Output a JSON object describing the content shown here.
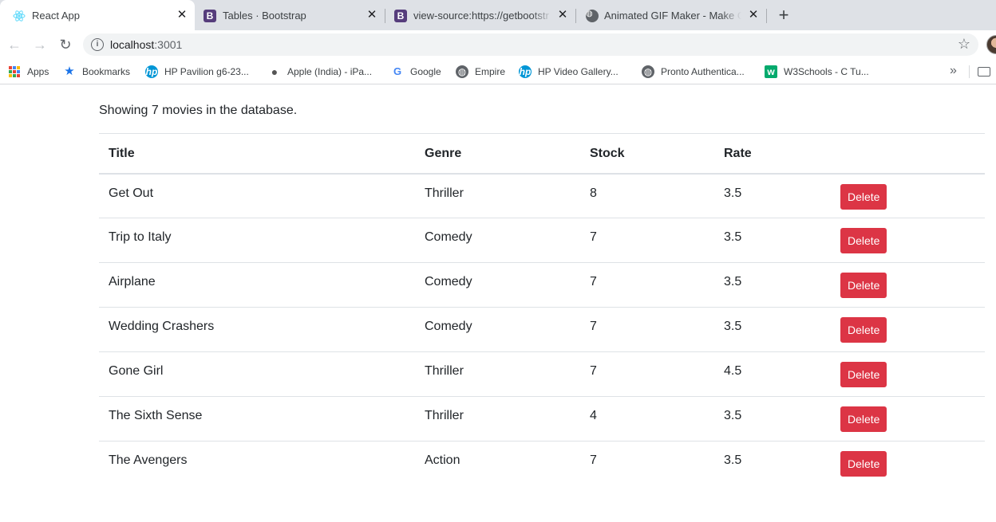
{
  "browser": {
    "tabs": [
      {
        "title": "React App",
        "icon": "react-icon"
      },
      {
        "title": "Tables · Bootstrap",
        "icon": "bootstrap-icon"
      },
      {
        "title": "view-source:https://getbootstr",
        "icon": "bootstrap-icon"
      },
      {
        "title": "Animated GIF Maker - Make GI",
        "icon": "globe-icon"
      }
    ],
    "new_tab": "+",
    "url_host": "localhost",
    "url_port": ":3001",
    "bookmarks": [
      {
        "label": "Apps",
        "icon": "apps-grid-icon"
      },
      {
        "label": "Bookmarks",
        "icon": "star-icon"
      },
      {
        "label": "HP Pavilion g6-23...",
        "icon": "hp-icon"
      },
      {
        "label": "Apple (India) - iPa...",
        "icon": "apple-icon"
      },
      {
        "label": "Google",
        "icon": "google-icon"
      },
      {
        "label": "Empire",
        "icon": "globe-icon"
      },
      {
        "label": "HP Video Gallery...",
        "icon": "hp-icon"
      },
      {
        "label": "Pronto Authentica...",
        "icon": "globe-icon"
      },
      {
        "label": "W3Schools - C Tu...",
        "icon": "w3schools-icon"
      }
    ]
  },
  "page": {
    "summary": "Showing 7 movies in the database.",
    "columns": [
      "Title",
      "Genre",
      "Stock",
      "Rate"
    ],
    "delete_label": "Delete",
    "movies": [
      {
        "title": "Get Out",
        "genre": "Thriller",
        "stock": "8",
        "rate": "3.5"
      },
      {
        "title": "Trip to Italy",
        "genre": "Comedy",
        "stock": "7",
        "rate": "3.5"
      },
      {
        "title": "Airplane",
        "genre": "Comedy",
        "stock": "7",
        "rate": "3.5"
      },
      {
        "title": "Wedding Crashers",
        "genre": "Comedy",
        "stock": "7",
        "rate": "3.5"
      },
      {
        "title": "Gone Girl",
        "genre": "Thriller",
        "stock": "7",
        "rate": "4.5"
      },
      {
        "title": "The Sixth Sense",
        "genre": "Thriller",
        "stock": "4",
        "rate": "3.5"
      },
      {
        "title": "The Avengers",
        "genre": "Action",
        "stock": "7",
        "rate": "3.5"
      }
    ]
  },
  "colors": {
    "danger": "#dc3545",
    "tabstrip": "#dee1e6",
    "border": "#dee2e6"
  }
}
